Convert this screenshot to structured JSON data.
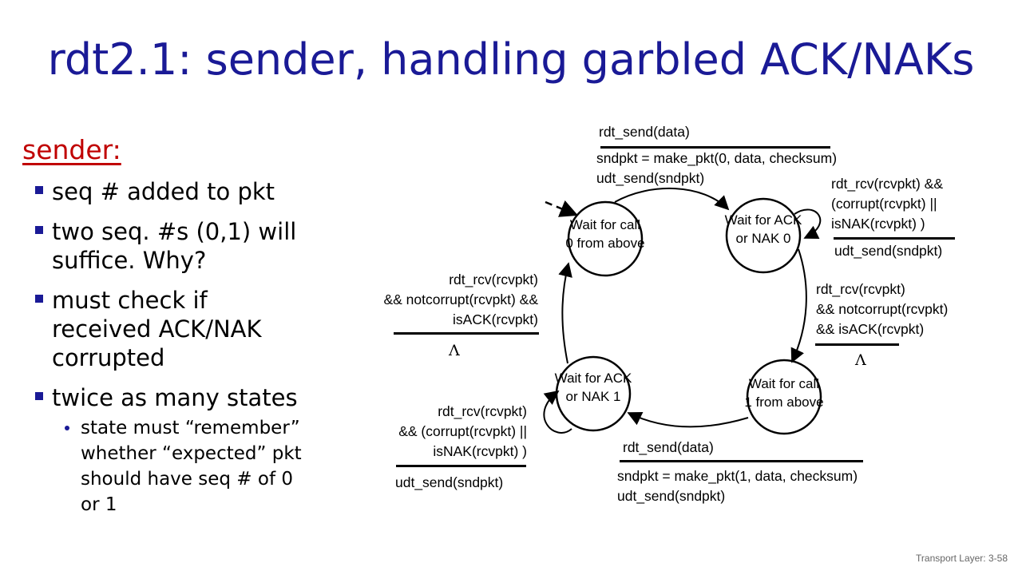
{
  "slide": {
    "title": "rdt2.1: sender, handling garbled ACK/NAKs",
    "footer": "Transport Layer: 3-58"
  },
  "left": {
    "heading": "sender:",
    "bullets": [
      "seq # added to pkt",
      "two seq. #s (0,1) will suffice.  Why?",
      "must check if received ACK/NAK corrupted",
      "twice as many states"
    ],
    "sub_bullet": "state must “remember” whether “expected” pkt should have seq # of 0 or 1"
  },
  "states": {
    "s0": "Wait for\ncall 0 from\nabove",
    "s1": "Wait for\nACK or\nNAK 0",
    "s2": "Wait for\ncall 1 from\nabove",
    "s3": "Wait for\nACK or\nNAK 1"
  },
  "transitions": {
    "t01": {
      "event": "rdt_send(data)",
      "action": "sndpkt = make_pkt(0, data, checksum)\nudt_send(sndpkt)"
    },
    "t11": {
      "event": "rdt_rcv(rcvpkt) &&\n(corrupt(rcvpkt) ||\nisNAK(rcvpkt) )",
      "action": "udt_send(sndpkt)"
    },
    "t12": {
      "event": "rdt_rcv(rcvpkt)\n&& notcorrupt(rcvpkt)\n&& isACK(rcvpkt)",
      "action": "Λ"
    },
    "t23": {
      "event": "rdt_send(data)",
      "action": "sndpkt = make_pkt(1, data, checksum)\nudt_send(sndpkt)"
    },
    "t33": {
      "event": "rdt_rcv(rcvpkt)\n&& (corrupt(rcvpkt) ||\nisNAK(rcvpkt) )",
      "action": "udt_send(sndpkt)"
    },
    "t30": {
      "event": "rdt_rcv(rcvpkt)\n&& notcorrupt(rcvpkt) &&\nisACK(rcvpkt)",
      "action": "Λ"
    }
  }
}
